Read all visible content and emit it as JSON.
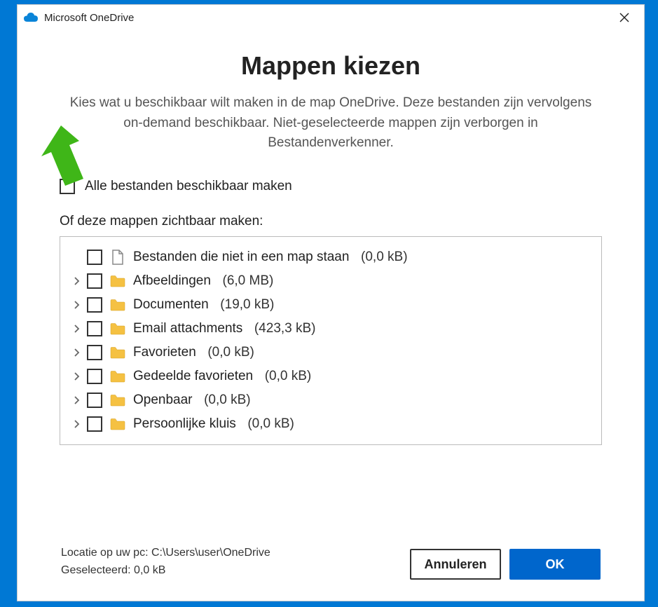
{
  "window": {
    "title": "Microsoft OneDrive"
  },
  "heading": "Mappen kiezen",
  "description": "Kies wat u beschikbaar wilt maken in de map OneDrive. Deze bestanden zijn vervolgens on-demand beschikbaar. Niet-geselecteerde mappen zijn verborgen in Bestandenverkenner.",
  "select_all_label": "Alle bestanden beschikbaar maken",
  "subheading": "Of deze mappen zichtbaar maken:",
  "folders": [
    {
      "expandable": false,
      "icon": "file",
      "name": "Bestanden die niet in een map staan",
      "size": "(0,0 kB)"
    },
    {
      "expandable": true,
      "icon": "folder",
      "name": "Afbeeldingen",
      "size": "(6,0 MB)"
    },
    {
      "expandable": true,
      "icon": "folder",
      "name": "Documenten",
      "size": "(19,0 kB)"
    },
    {
      "expandable": true,
      "icon": "folder",
      "name": "Email attachments",
      "size": "(423,3 kB)"
    },
    {
      "expandable": true,
      "icon": "folder",
      "name": "Favorieten",
      "size": "(0,0 kB)"
    },
    {
      "expandable": true,
      "icon": "folder",
      "name": "Gedeelde favorieten",
      "size": "(0,0 kB)"
    },
    {
      "expandable": true,
      "icon": "folder",
      "name": "Openbaar",
      "size": "(0,0 kB)"
    },
    {
      "expandable": true,
      "icon": "folder",
      "name": "Persoonlijke kluis",
      "size": "(0,0 kB)"
    }
  ],
  "location_label": "Locatie op uw pc: C:\\Users\\user\\OneDrive",
  "selected_label": "Geselecteerd: 0,0 kB",
  "buttons": {
    "cancel": "Annuleren",
    "ok": "OK"
  },
  "colors": {
    "accent": "#0066cc",
    "arrow": "#3fb618",
    "folder": "#f5c142"
  }
}
